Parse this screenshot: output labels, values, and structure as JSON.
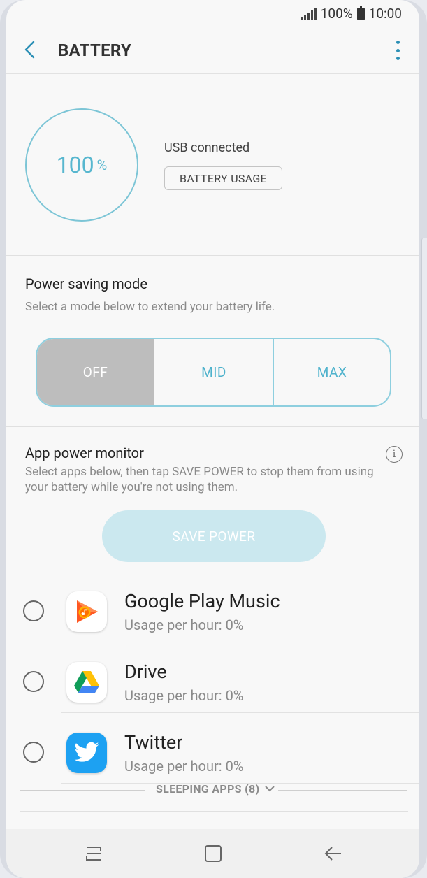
{
  "status_bar": {
    "battery": "100%",
    "time": "10:00"
  },
  "app_bar": {
    "title": "BATTERY"
  },
  "battery": {
    "percent": "100",
    "percent_sign": "%",
    "status": "USB connected",
    "usage_button": "BATTERY USAGE",
    "ring_color": "#7cc5d6"
  },
  "power_saving": {
    "title": "Power saving mode",
    "subtitle": "Select a mode below to extend your battery life.",
    "modes": [
      "OFF",
      "MID",
      "MAX"
    ],
    "selected": "OFF"
  },
  "app_power_monitor": {
    "title": "App power monitor",
    "description": "Select apps below, then tap SAVE POWER to stop them from using your battery while you're not using them.",
    "save_button": "SAVE POWER",
    "apps": [
      {
        "name": "Google Play Music",
        "usage": "Usage per hour: 0%",
        "icon": "google-play-music-icon"
      },
      {
        "name": "Drive",
        "usage": "Usage per hour: 0%",
        "icon": "google-drive-icon"
      },
      {
        "name": "Twitter",
        "usage": "Usage per hour: 0%",
        "icon": "twitter-icon"
      }
    ],
    "sleeping_apps": "SLEEPING APPS (8)"
  },
  "colors": {
    "accent": "#4eb2cc",
    "selected_mode": "#bdbdbd",
    "save_button_disabled": "#cbe8ef"
  }
}
